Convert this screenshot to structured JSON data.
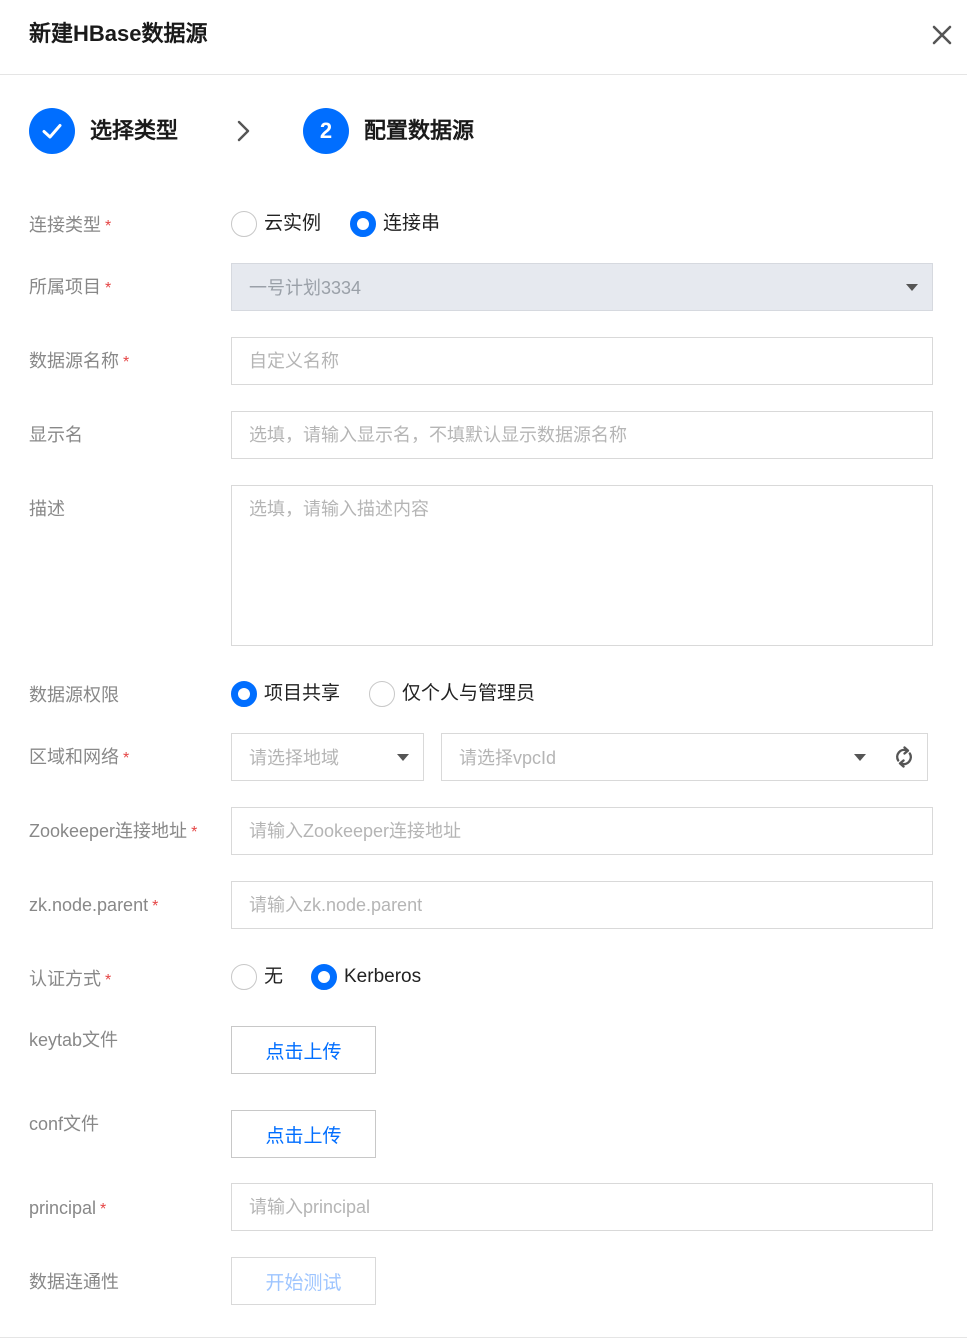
{
  "dialog": {
    "title": "新建HBase数据源"
  },
  "steps": [
    {
      "label": "选择类型",
      "status": "done"
    },
    {
      "label": "配置数据源",
      "number": "2",
      "status": "active"
    }
  ],
  "form": {
    "connection_type": {
      "label": "连接类型",
      "options": [
        "云实例",
        "连接串"
      ],
      "selected": "连接串"
    },
    "project": {
      "label": "所属项目",
      "value": "一号计划3334"
    },
    "datasource_name": {
      "label": "数据源名称",
      "placeholder": "自定义名称"
    },
    "display_name": {
      "label": "显示名",
      "placeholder": "选填，请输入显示名，不填默认显示数据源名称"
    },
    "description": {
      "label": "描述",
      "placeholder": "选填，请输入描述内容"
    },
    "permission": {
      "label": "数据源权限",
      "options": [
        "项目共享",
        "仅个人与管理员"
      ],
      "selected": "项目共享"
    },
    "region_network": {
      "label": "区域和网络",
      "region_placeholder": "请选择地域",
      "vpc_placeholder": "请选择vpcId"
    },
    "zookeeper": {
      "label": "Zookeeper连接地址",
      "placeholder": "请输入Zookeeper连接地址"
    },
    "zk_parent": {
      "label": "zk.node.parent",
      "placeholder": "请输入zk.node.parent"
    },
    "auth_method": {
      "label": "认证方式",
      "options": [
        "无",
        "Kerberos"
      ],
      "selected": "Kerberos"
    },
    "keytab": {
      "label": "keytab文件",
      "button": "点击上传"
    },
    "conf": {
      "label": "conf文件",
      "button": "点击上传"
    },
    "principal": {
      "label": "principal",
      "placeholder": "请输入principal"
    },
    "connectivity": {
      "label": "数据连通性",
      "button": "开始测试"
    },
    "required_mark": "*"
  },
  "colors": {
    "primary": "#006eff",
    "required": "#e54545",
    "label": "#888888"
  }
}
